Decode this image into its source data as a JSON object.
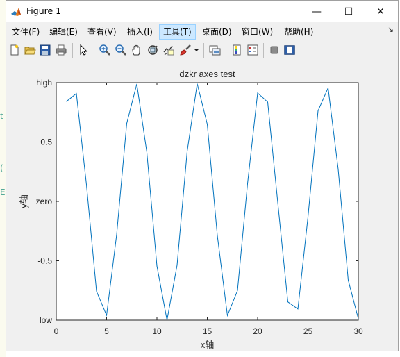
{
  "window": {
    "title": "Figure 1",
    "controls": {
      "minimize": "—",
      "maximize": "☐",
      "close": "✕"
    }
  },
  "menu": {
    "items": [
      "文件(F)",
      "编辑(E)",
      "查看(V)",
      "插入(I)",
      "工具(T)",
      "桌面(D)",
      "窗口(W)",
      "帮助(H)"
    ],
    "active_index": 4,
    "dock_glyph": "↘"
  },
  "toolbar": {
    "icons": [
      "new-figure-icon",
      "open-file-icon",
      "save-icon",
      "print-icon",
      "pointer-icon",
      "zoom-in-icon",
      "zoom-out-icon",
      "pan-icon",
      "rotate-3d-icon",
      "data-cursor-icon",
      "brush-icon",
      "brush-dropdown-icon",
      "link-plot-icon",
      "colorbar-icon",
      "legend-icon",
      "hide-plot-tools-icon",
      "show-plot-tools-icon"
    ]
  },
  "chart_data": {
    "type": "line",
    "title": "dzkr axes test",
    "xlabel": "x轴",
    "ylabel": "y轴",
    "xlim": [
      0,
      30
    ],
    "ylim": [
      -1,
      1
    ],
    "xticks": [
      0,
      5,
      10,
      15,
      20,
      25,
      30
    ],
    "xtick_labels": [
      "0",
      "5",
      "10",
      "15",
      "20",
      "25",
      "30"
    ],
    "yticks": [
      -1,
      -0.5,
      0,
      0.5,
      1
    ],
    "ytick_labels": [
      "low",
      "-0.5",
      "zero",
      "0.5",
      "high"
    ],
    "grid": false,
    "series": [
      {
        "color": "#0072bd",
        "x": [
          1,
          2,
          3,
          4,
          5,
          6,
          7,
          8,
          9,
          10,
          11,
          12,
          13,
          14,
          15,
          16,
          17,
          18,
          19,
          20,
          21,
          22,
          23,
          24,
          25,
          26,
          27,
          28,
          29,
          30
        ],
        "y": [
          0.841,
          0.909,
          0.141,
          -0.757,
          -0.959,
          -0.279,
          0.657,
          0.989,
          0.412,
          -0.544,
          -1.0,
          -0.537,
          0.42,
          0.991,
          0.65,
          -0.288,
          -0.961,
          -0.751,
          0.15,
          0.913,
          0.837,
          -0.009,
          -0.846,
          -0.906,
          -0.132,
          0.763,
          0.956,
          0.271,
          -0.664,
          -0.988
        ]
      }
    ]
  }
}
